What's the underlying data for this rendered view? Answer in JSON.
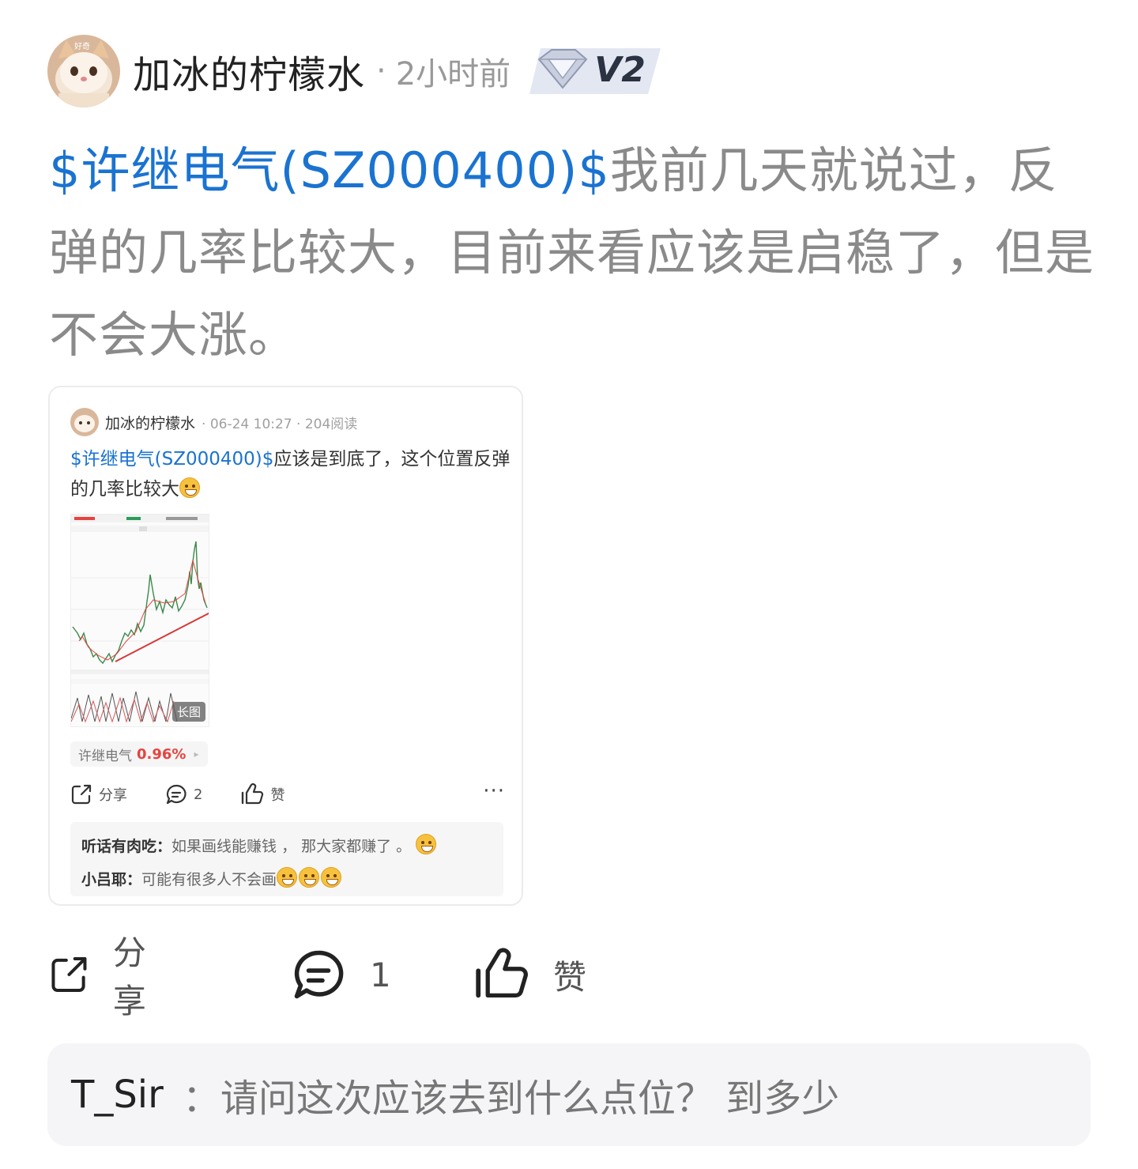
{
  "post": {
    "author": "加冰的柠檬水",
    "separator": "·",
    "time": "2小时前",
    "level_badge": "V2",
    "stock_tag": "$许继电气(SZ000400)$",
    "text": "我前几天就说过，反弹的几率比较大，目前来看应该是启稳了，但是不会大涨。",
    "avatar_label": "好奇"
  },
  "quoted": {
    "author": "加冰的柠檬水",
    "meta": "· 06-24 10:27 · 204阅读",
    "stock_tag": "$许继电气(SZ000400)$",
    "text": "应该是到底了，这个位置反弹的几率比较大",
    "image_tag": "长图",
    "stock_chip": {
      "name": "许继电气",
      "change": "0.96%"
    },
    "actions": {
      "share": "分享",
      "comments": "2",
      "like": "赞",
      "more": "···"
    },
    "comments": [
      {
        "user": "听话有肉吃",
        "text": "如果画线能赚钱 ， 那大家都赚了 。",
        "emojis": 1
      },
      {
        "user": "小吕耶",
        "text": "可能有很多人不会画",
        "emojis": 3
      }
    ],
    "colors": {
      "tag": "#1a73d1",
      "up": "#e64340",
      "down": "#2a9d5a"
    }
  },
  "actions": {
    "share": "分享",
    "comments": "1",
    "like": "赞"
  },
  "comment": {
    "user": "T_Sir",
    "separator": "：",
    "text": "请问这次应该去到什么点位？ 到多少"
  }
}
